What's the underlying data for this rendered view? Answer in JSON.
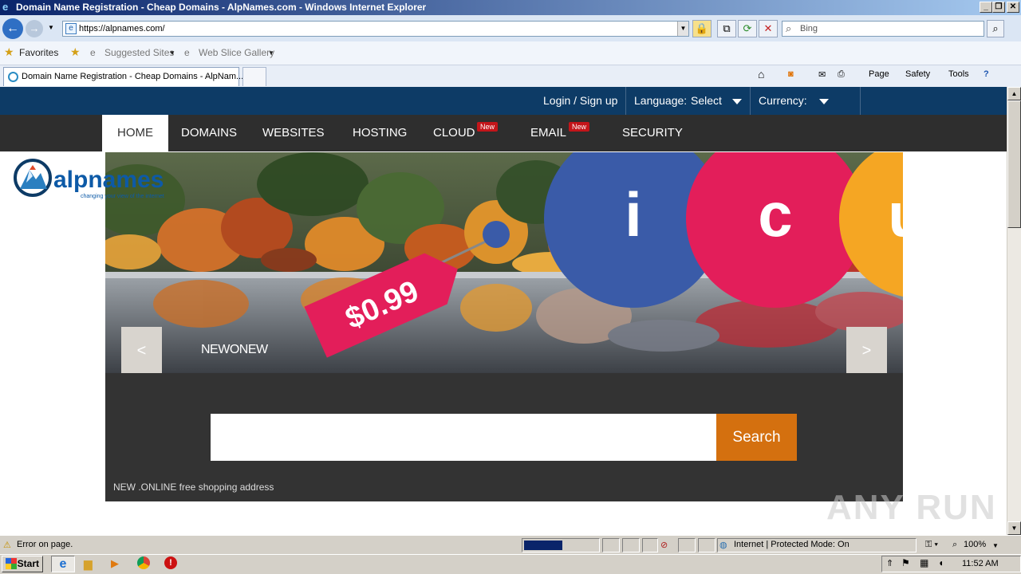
{
  "window": {
    "title": "Domain Name Registration - Cheap Domains - AlpNames.com - Windows Internet Explorer",
    "minimize": "_",
    "restore": "❐",
    "close": "✕"
  },
  "addressbar": {
    "url": "https://alpnames.com/",
    "search_placeholder": "Bing"
  },
  "favorites": {
    "favorites_label": "Favorites",
    "suggested_sites": "Suggested Sites",
    "web_slice_gallery": "Web Slice Gallery"
  },
  "tabs": {
    "active_tab": "Domain Name Registration - Cheap Domains - AlpNam...",
    "commands": {
      "page": "Page",
      "safety": "Safety",
      "tools": "Tools"
    }
  },
  "site": {
    "topbar": {
      "login": "Login / Sign up",
      "language_label": "Language:",
      "language_value": "Select",
      "currency_label": "Currency:"
    },
    "nav": {
      "home": "HOME",
      "domains": "DOMAINS",
      "websites": "WEBSITES",
      "hosting": "HOSTING",
      "cloud": "CLOUD",
      "email": "EMAIL",
      "security": "SECURITY",
      "new_badge": "New"
    },
    "logo": {
      "name": "alpnames",
      "tagline": "changing your view of the internet"
    },
    "hero": {
      "price": "$0.99",
      "tld_letters": [
        "i",
        "c",
        "u"
      ],
      "prev": "<",
      "next": ">",
      "slide_text": "NEWONEW"
    },
    "search": {
      "input_value": "",
      "button": "Search",
      "ticker": "NEW .ONLINE free shopping address"
    }
  },
  "statusbar": {
    "message": "Error on page.",
    "zone": "Internet | Protected Mode: On",
    "zoom": "100%"
  },
  "taskbar": {
    "start": "Start",
    "clock": "11:52 AM"
  },
  "watermark": "ANY RUN",
  "colors": {
    "site_topbar": "#0d3b66",
    "site_nav": "#2e2e2e",
    "search_button": "#d4700f",
    "new_badge": "#c3151a",
    "circle_blue": "#3a5ba8",
    "circle_pink": "#e31e5a",
    "circle_orange": "#f5a623"
  }
}
